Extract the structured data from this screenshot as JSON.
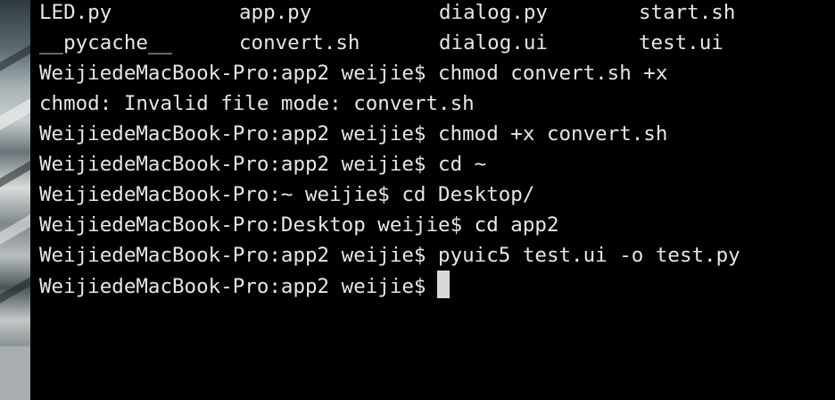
{
  "terminal": {
    "ls_output": [
      [
        "LED.py",
        "app.py",
        "dialog.py",
        "start.sh"
      ],
      [
        "__pycache__",
        "convert.sh",
        "dialog.ui",
        "test.ui"
      ]
    ],
    "lines": [
      "WeijiedeMacBook-Pro:app2 weijie$ chmod convert.sh +x",
      "chmod: Invalid file mode: convert.sh",
      "WeijiedeMacBook-Pro:app2 weijie$ chmod +x convert.sh",
      "WeijiedeMacBook-Pro:app2 weijie$ cd ~",
      "WeijiedeMacBook-Pro:~ weijie$ cd Desktop/",
      "WeijiedeMacBook-Pro:Desktop weijie$ cd app2",
      "WeijiedeMacBook-Pro:app2 weijie$ pyuic5 test.ui -o test.py"
    ],
    "prompt": "WeijiedeMacBook-Pro:app2 weijie$",
    "colors": {
      "background": "#000000",
      "text": "#e6e6e6",
      "cursor": "#d8d8d8"
    }
  }
}
